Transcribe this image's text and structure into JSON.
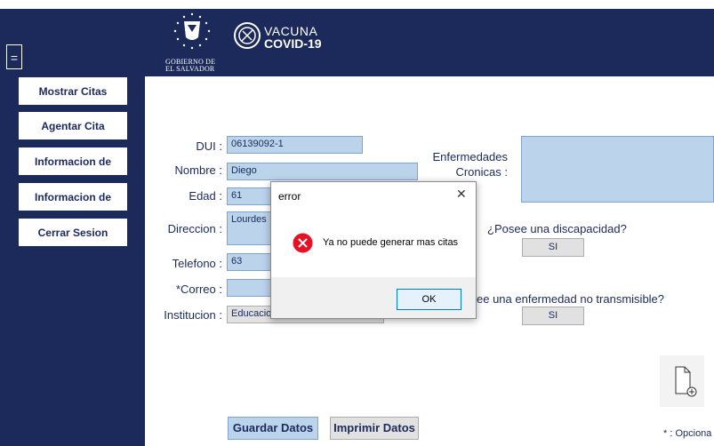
{
  "header": {
    "menu_icon": "hamburger-icon",
    "seal_icon": "el-salvador-seal-icon",
    "seal_caption_line1": "GOBIERNO DE",
    "seal_caption_line2": "EL SALVADOR",
    "vaccine_logo_icon": "vaccine-logo-icon",
    "vaccine_title_line1": "VACUNA",
    "vaccine_title_line2": "COVID-19",
    "colors": {
      "navy": "#1b2a5b",
      "field_blue": "#bcd3ec"
    }
  },
  "sidebar": {
    "items": [
      {
        "label": "Mostrar Citas"
      },
      {
        "label": "Agentar Cita"
      },
      {
        "label": "Informacion de"
      },
      {
        "label": "Informacion de"
      },
      {
        "label": "Cerrar Sesion"
      }
    ]
  },
  "form": {
    "dui_label": "DUI :",
    "dui_value": "06139092-1",
    "nombre_label": "Nombre :",
    "nombre_value": "Diego",
    "edad_label": "Edad :",
    "edad_value": "61",
    "direccion_label": "Direccion :",
    "direccion_value": "Lourdes",
    "telefono_label": "Telefono :",
    "telefono_value": "63",
    "correo_label": "*Correo :",
    "correo_value": "",
    "institucion_label": "Institucion :",
    "institucion_value": "Educacion",
    "enfermedades_label_line1": "Enfermedades",
    "enfermedades_label_line2": "Cronicas :",
    "enfermedades_value": "",
    "discapacidad_label": "¿Posee una discapacidad?",
    "discapacidad_button": "SI",
    "no_transmisible_label": "ee una enfermedad no transmisible?",
    "no_transmisible_button": "SI",
    "guardar_button": "Guardar Datos",
    "imprimir_button": "Imprimir Datos",
    "optional_note": "* : Opciona",
    "add_file_icon": "add-file-icon"
  },
  "dialog": {
    "title": "error",
    "close_icon": "close-icon",
    "error_icon": "error-icon",
    "message": "Ya no puede generar mas citas",
    "ok_label": "OK"
  }
}
